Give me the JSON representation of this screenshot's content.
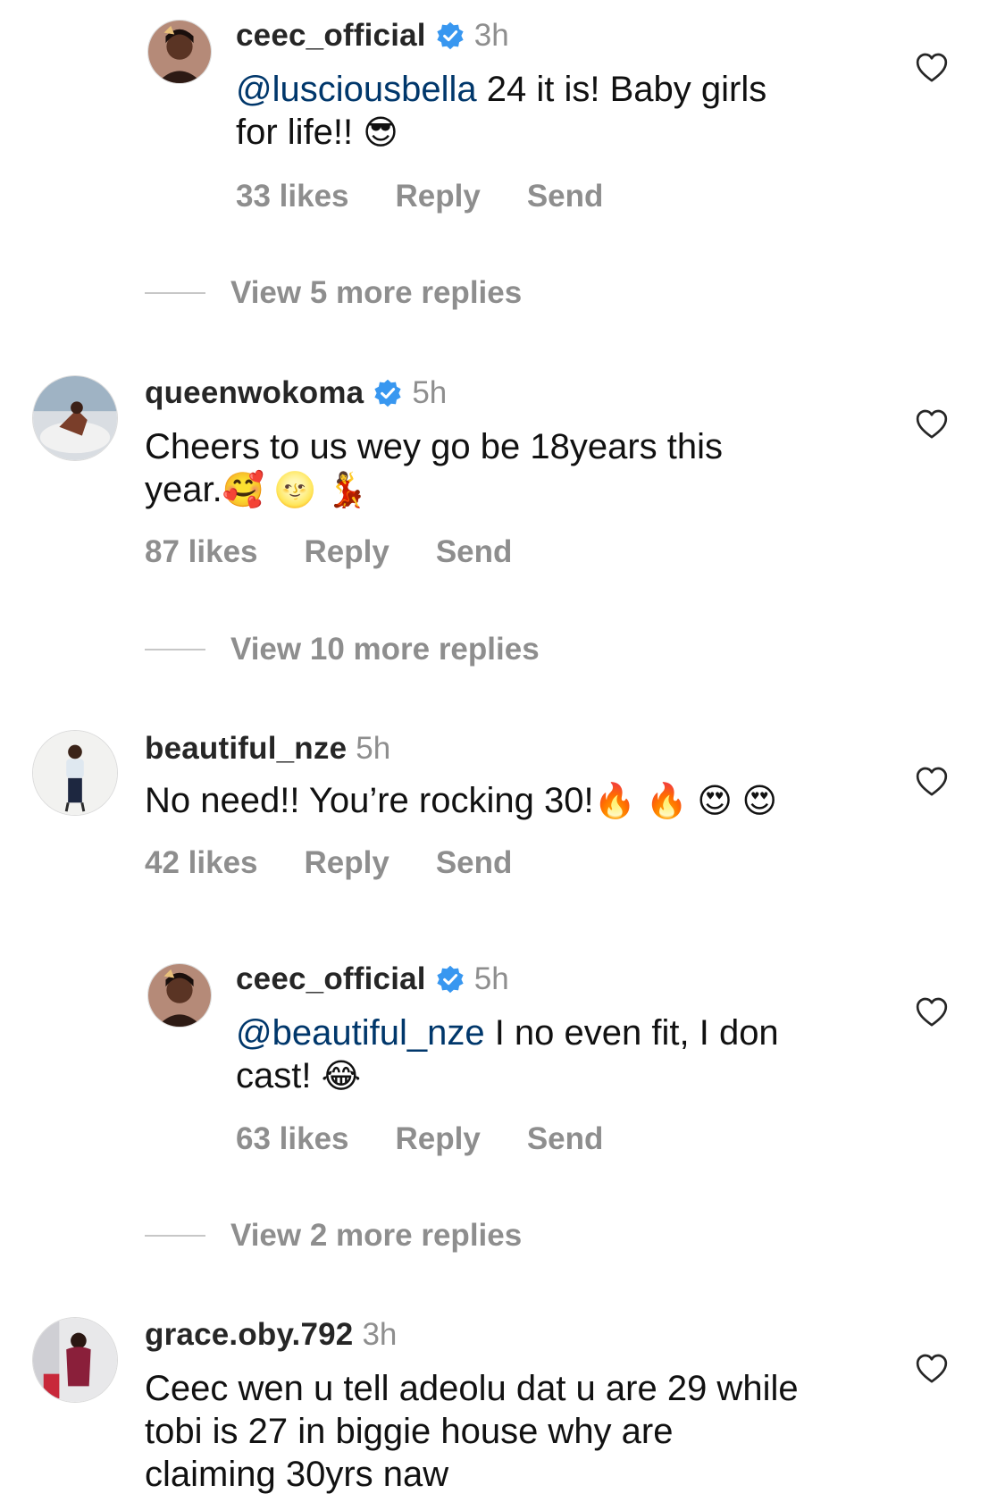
{
  "comments": [
    {
      "username": "ceec_official",
      "verified": true,
      "time": "3h",
      "mention": "@lusciousbella",
      "text_line1": " 24 it is! Baby girls",
      "text_line2": "for life!! ",
      "emoji": "😎",
      "likes": "33 likes",
      "reply": "Reply",
      "send": "Send"
    },
    {
      "username": "queenwokoma",
      "verified": true,
      "time": "5h",
      "text_line1": "Cheers to us wey go be 18years this",
      "text_line2": "year.",
      "emoji": "🥰 🌝 💃",
      "likes": "87 likes",
      "reply": "Reply",
      "send": "Send"
    },
    {
      "username": "beautiful_nze",
      "verified": false,
      "time": "5h",
      "text_line1": "No need!! You’re rocking 30!",
      "emoji": "🔥 🔥 😍 😍",
      "likes": "42 likes",
      "reply": "Reply",
      "send": "Send"
    },
    {
      "username": "ceec_official",
      "verified": true,
      "time": "5h",
      "mention": "@beautiful_nze",
      "text_line1": " I no even fit, I don",
      "text_line2": "cast! ",
      "emoji": "😂",
      "likes": "63 likes",
      "reply": "Reply",
      "send": "Send"
    },
    {
      "username": "grace.oby.792",
      "verified": false,
      "time": "3h",
      "text_line1": "Ceec wen u tell adeolu dat u are 29 while",
      "text_line2": "tobi is 27 in biggie house why are",
      "text_line3": "claiming 30yrs naw"
    }
  ],
  "view_more": [
    "View 5 more replies",
    "View 10 more replies",
    "View 2 more replies"
  ],
  "colors": {
    "mention": "#00376b",
    "verified": "#3897f0",
    "muted": "#8e8e8e"
  },
  "icons": {
    "verified": "verified-badge-icon",
    "like": "heart-outline-icon"
  }
}
